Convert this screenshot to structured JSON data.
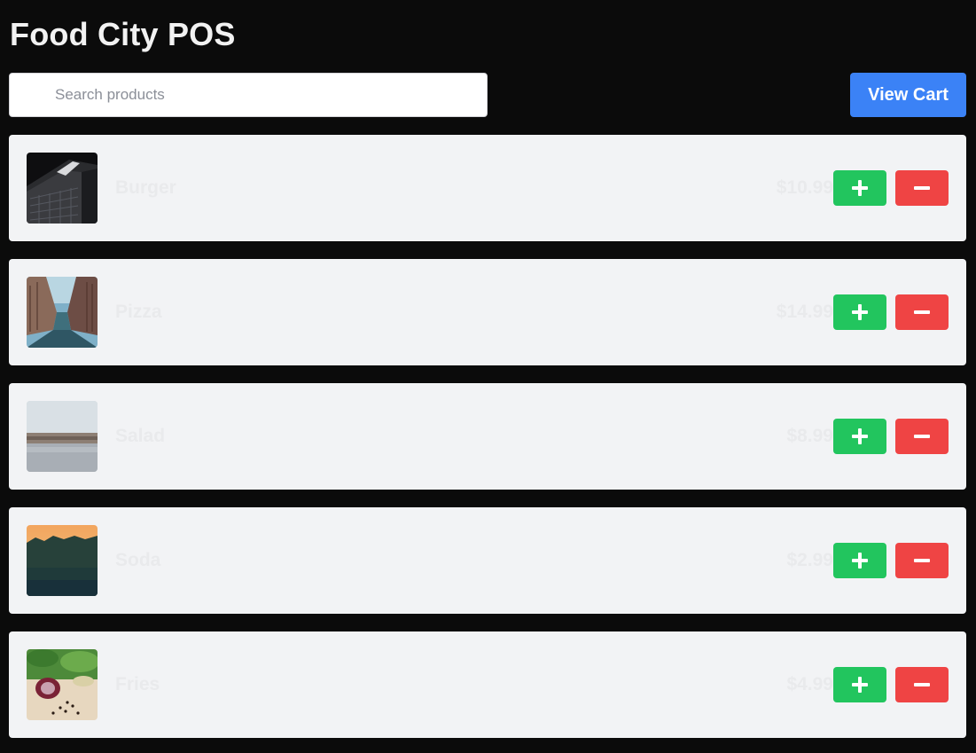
{
  "header": {
    "title": "Food City POS"
  },
  "search": {
    "placeholder": "Search products",
    "value": "",
    "icon": "search-icon"
  },
  "toolbar": {
    "view_cart_label": "View Cart"
  },
  "products": [
    {
      "name": "Burger",
      "price": "$10.99",
      "image": "city-buildings-photo"
    },
    {
      "name": "Pizza",
      "price": "$14.99",
      "image": "street-photo"
    },
    {
      "name": "Salad",
      "price": "$8.99",
      "image": "lake-photo"
    },
    {
      "name": "Soda",
      "price": "$2.99",
      "image": "forest-photo"
    },
    {
      "name": "Fries",
      "price": "$4.99",
      "image": "onion-photo"
    }
  ],
  "buttons": {
    "add_icon": "plus-icon",
    "remove_icon": "minus-icon"
  },
  "colors": {
    "background": "#0b0b0b",
    "card": "#f2f3f5",
    "accent": "#3b82f6",
    "add": "#22c55e",
    "remove": "#ef4444"
  }
}
